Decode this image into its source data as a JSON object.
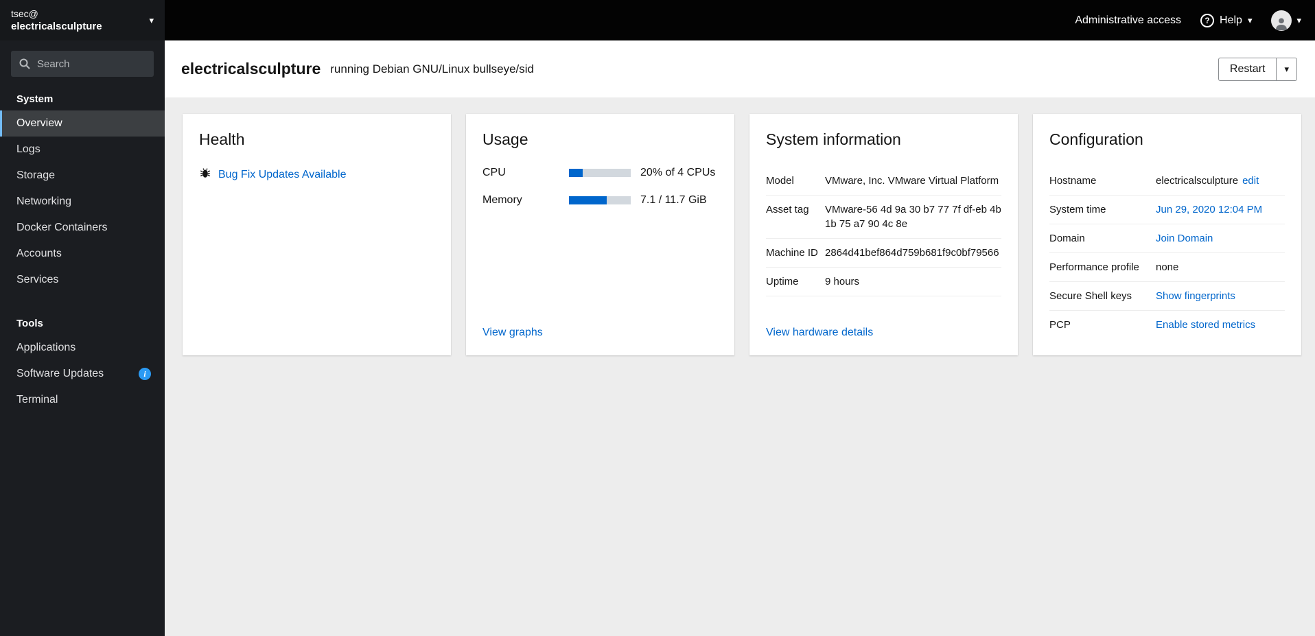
{
  "icons": {
    "caret": "▾",
    "help": "?",
    "info": "i"
  },
  "colors": {
    "accent_link": "#0066cc",
    "progress_fill": "#0066cc",
    "progress_track": "#d2d8de",
    "sidebar_bg": "#1b1d21",
    "masthead_bg": "#030303",
    "active_item_bg": "#3c3f42",
    "active_item_border": "#73bcf7",
    "info_badge": "#2b9af3"
  },
  "sidebar": {
    "user": "tsec@",
    "host": "electricalsculpture",
    "search": {
      "placeholder": "Search"
    },
    "sections": [
      {
        "title": "System",
        "items": [
          {
            "label": "Overview"
          },
          {
            "label": "Logs"
          },
          {
            "label": "Storage"
          },
          {
            "label": "Networking"
          },
          {
            "label": "Docker Containers"
          },
          {
            "label": "Accounts"
          },
          {
            "label": "Services"
          }
        ]
      },
      {
        "title": "Tools",
        "items": [
          {
            "label": "Applications"
          },
          {
            "label": "Software Updates"
          },
          {
            "label": "Terminal"
          }
        ]
      }
    ]
  },
  "masthead": {
    "admin_access_label": "Administrative access",
    "help_label": "Help"
  },
  "header": {
    "hostname": "electricalsculpture",
    "os": "running Debian GNU/Linux bullseye/sid",
    "restart_label": "Restart"
  },
  "health": {
    "title": "Health",
    "update_link": "Bug Fix Updates Available"
  },
  "usage": {
    "title": "Usage",
    "cpu_label": "CPU",
    "cpu_value": "20% of 4 CPUs",
    "cpu_percent": 22,
    "memory_label": "Memory",
    "memory_value": "7.1 / 11.7 GiB",
    "memory_percent": 61,
    "view_graphs_link": "View graphs"
  },
  "system_information": {
    "title": "System information",
    "rows": [
      {
        "label": "Model",
        "value": "VMware, Inc. VMware Virtual Platform"
      },
      {
        "label": "Asset tag",
        "value": "VMware-56 4d 9a 30 b7 77 7f df-eb 4b 1b 75 a7 90 4c 8e"
      },
      {
        "label": "Machine ID",
        "value": "2864d41bef864d759b681f9c0bf79566"
      },
      {
        "label": "Uptime",
        "value": "9 hours"
      }
    ],
    "link": "View hardware details"
  },
  "configuration": {
    "title": "Configuration",
    "hostname_label": "Hostname",
    "hostname_value": "electricalsculpture",
    "hostname_edit_link": "edit",
    "system_time_label": "System time",
    "system_time_value": "Jun 29, 2020 12:04 PM",
    "domain_label": "Domain",
    "domain_link": "Join Domain",
    "performance_label": "Performance profile",
    "performance_value": "none",
    "ssh_label": "Secure Shell keys",
    "ssh_link": "Show fingerprints",
    "pcp_label": "PCP",
    "pcp_link": "Enable stored metrics"
  }
}
